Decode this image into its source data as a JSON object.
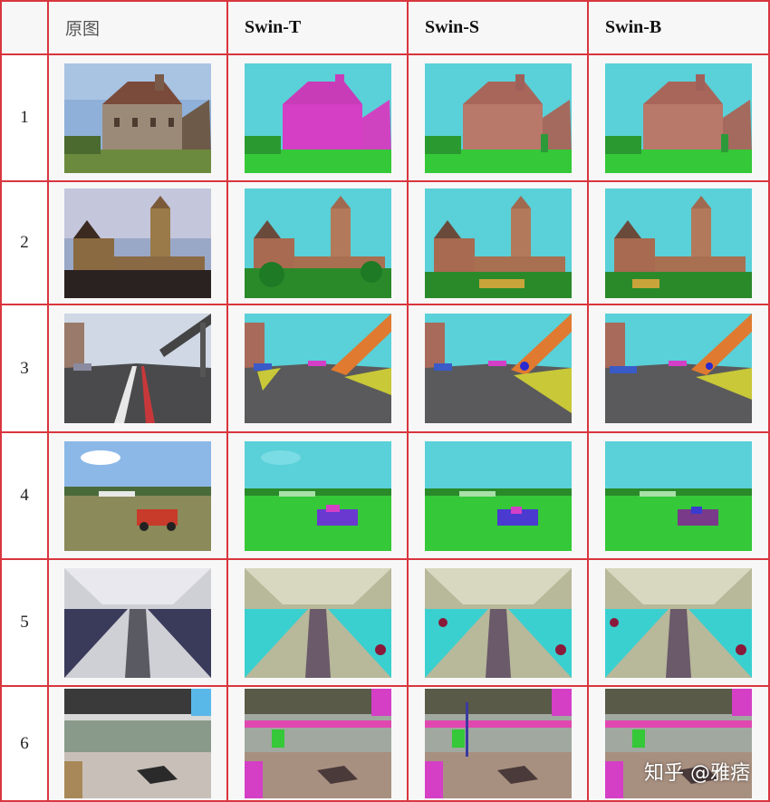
{
  "header": {
    "col0": "",
    "col1": "原图",
    "col2": "Swin-T",
    "col3": "Swin-S",
    "col4": "Swin-B"
  },
  "rows": [
    {
      "num": "1",
      "scene": "house"
    },
    {
      "num": "2",
      "scene": "castle"
    },
    {
      "num": "3",
      "scene": "street"
    },
    {
      "num": "4",
      "scene": "field"
    },
    {
      "num": "5",
      "scene": "aircraft"
    },
    {
      "num": "6",
      "scene": "market"
    }
  ],
  "watermark": "知乎 @雅痞",
  "colors": {
    "border": "#d9363e",
    "sky_seg": "#5ad0d8",
    "grass_seg": "#35c838",
    "building_seg_t": "#d43fc6"
  }
}
